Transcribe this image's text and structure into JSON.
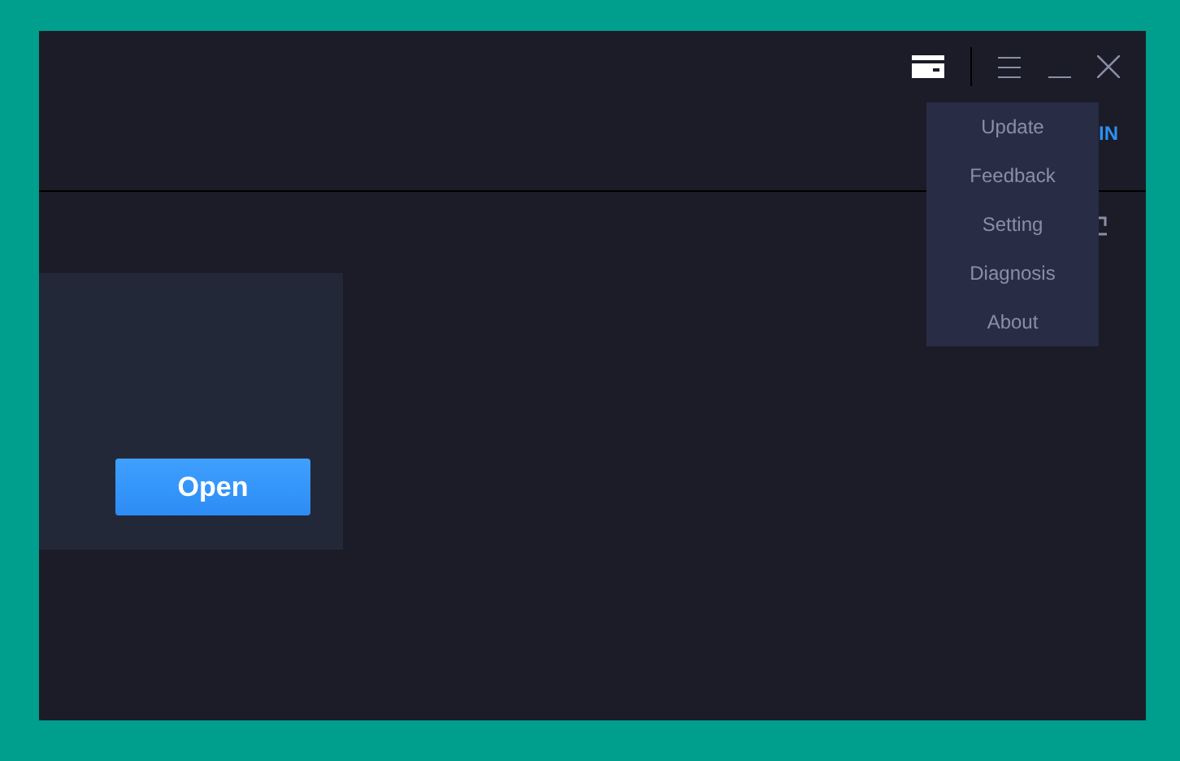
{
  "header": {
    "link": "IN"
  },
  "menu": {
    "items": [
      {
        "label": "Update"
      },
      {
        "label": "Feedback"
      },
      {
        "label": "Setting"
      },
      {
        "label": "Diagnosis"
      },
      {
        "label": "About"
      }
    ]
  },
  "card": {
    "button": "Open"
  }
}
